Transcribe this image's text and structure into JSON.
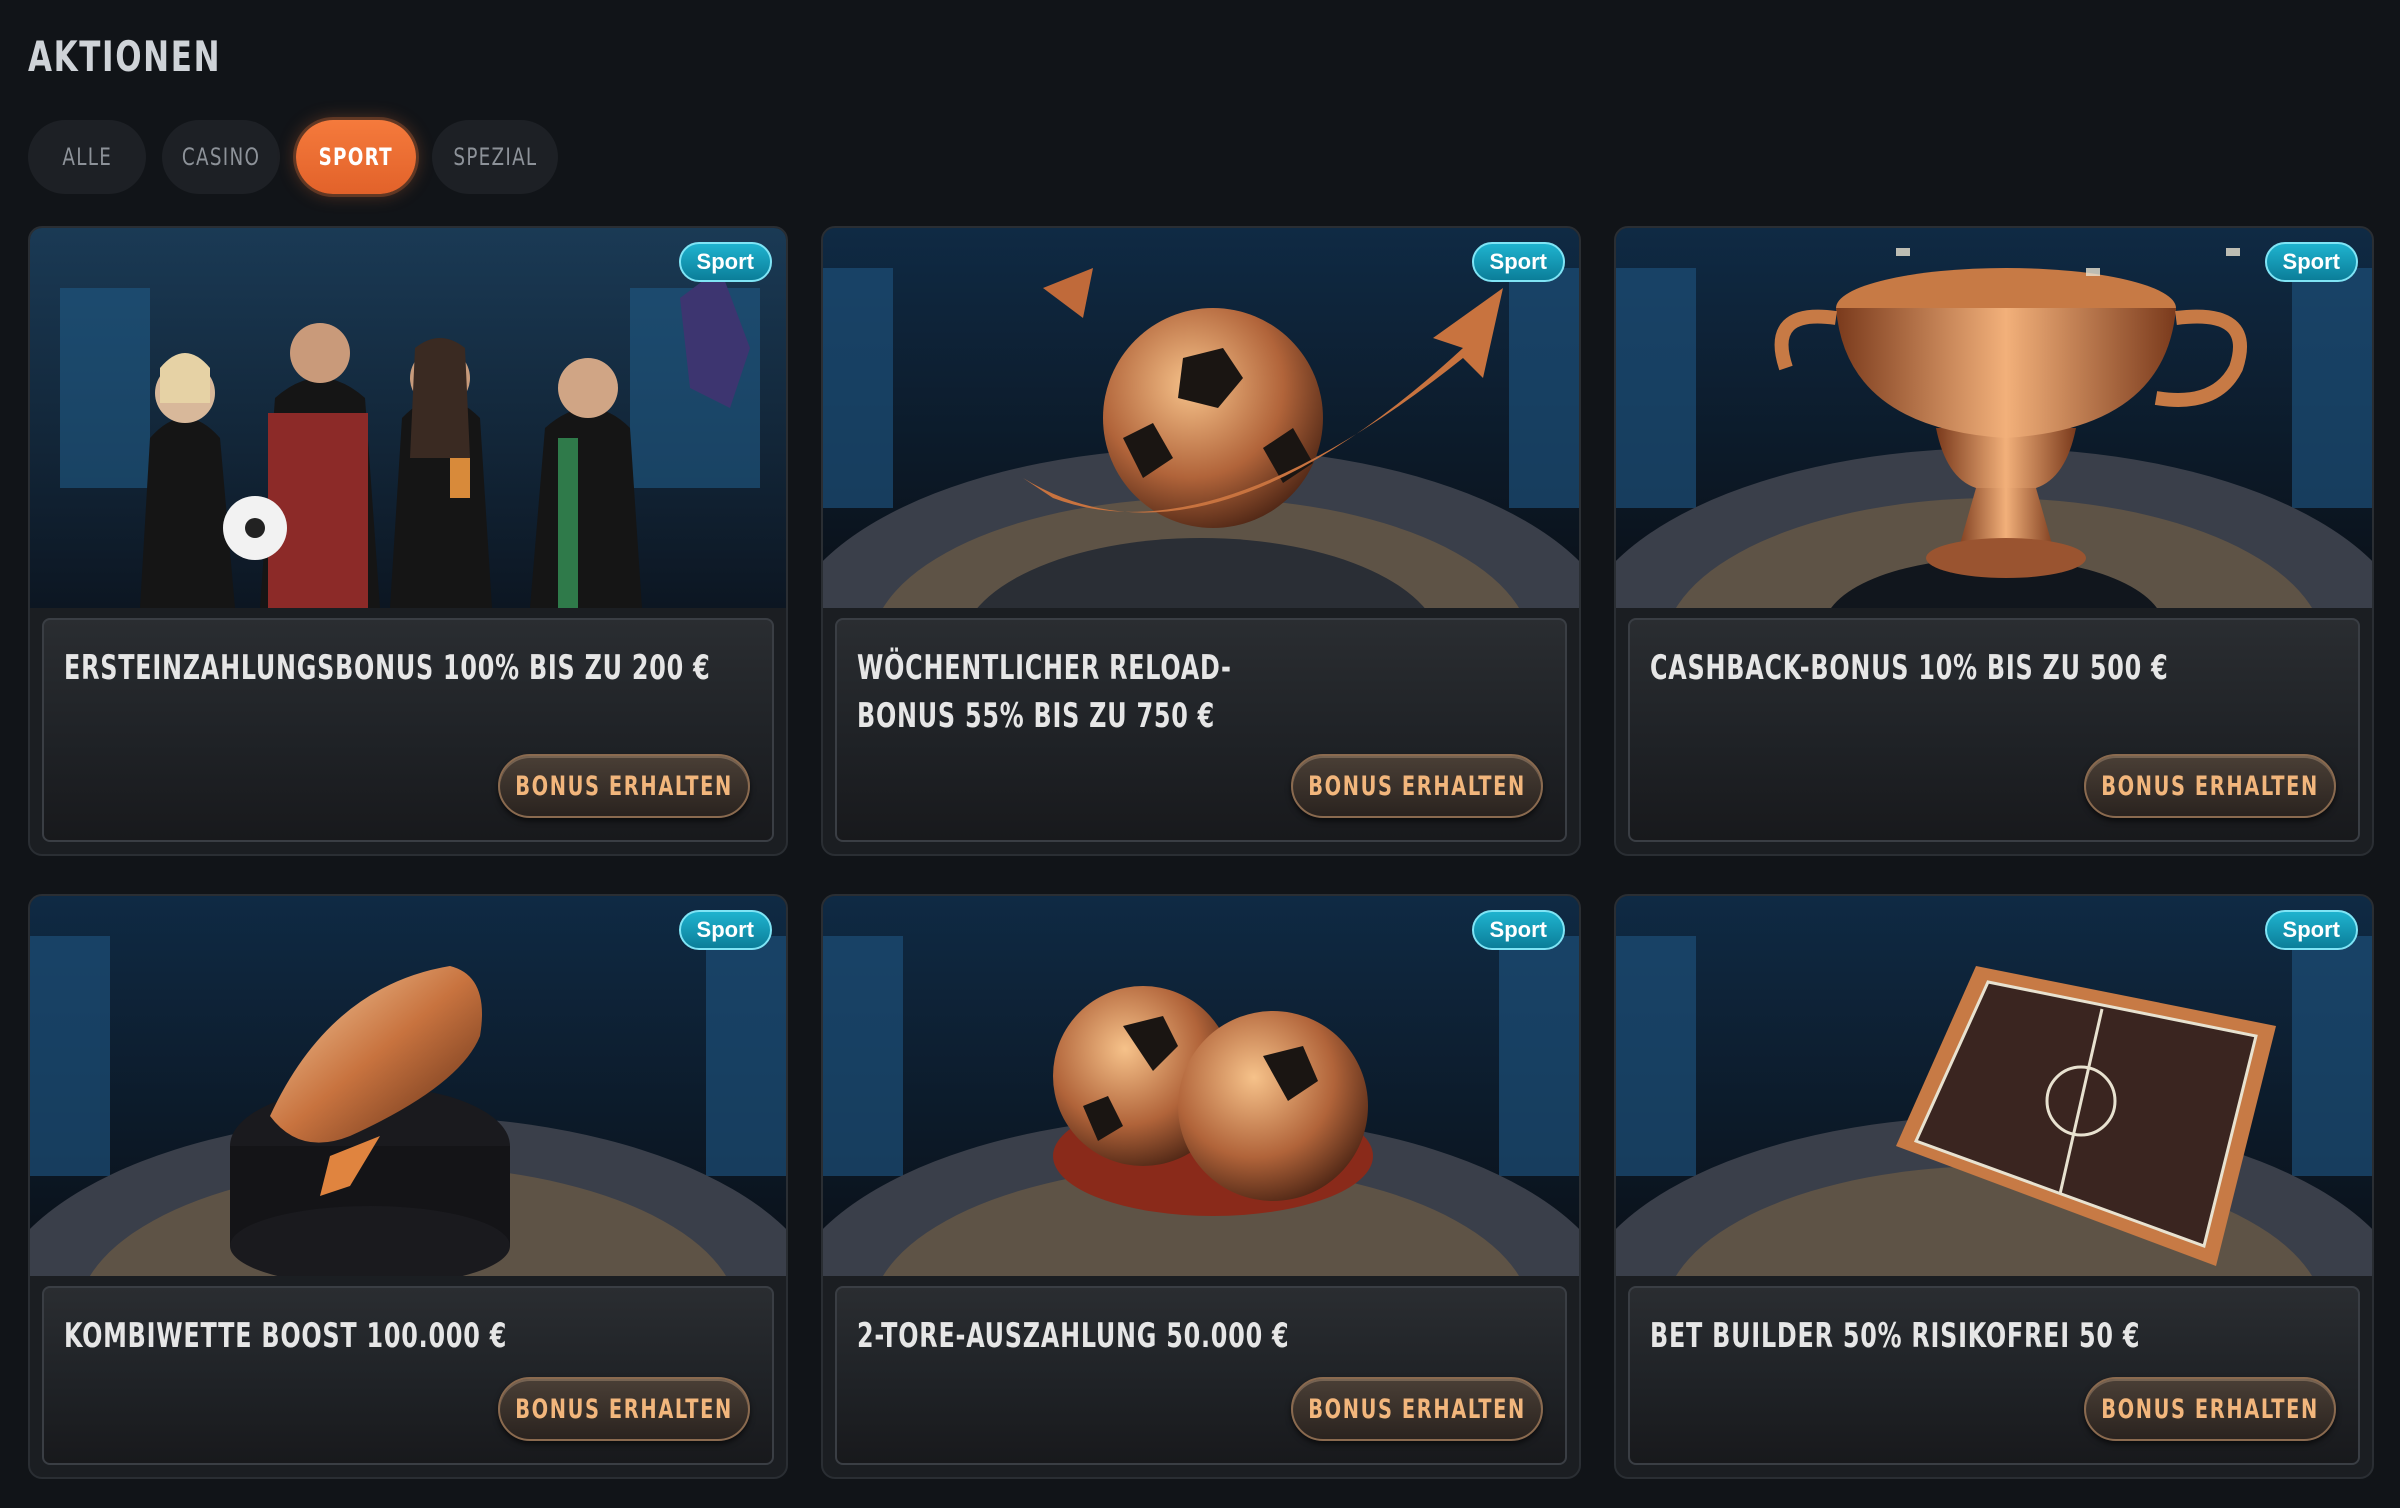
{
  "page": {
    "title": "AKTIONEN"
  },
  "tabs": [
    {
      "label": "ALLE",
      "active": false
    },
    {
      "label": "CASINO",
      "active": false
    },
    {
      "label": "SPORT",
      "active": true
    },
    {
      "label": "SPEZIAL",
      "active": false
    }
  ],
  "colors": {
    "accent": "#f57a3c",
    "badge": "#0b9ab7",
    "button_text": "#f2b67c",
    "background": "#111418"
  },
  "cards": [
    {
      "badge": "Sport",
      "title": "ERSTEINZAHLUNGSBONUS 100% BIS ZU 200 €",
      "button": "BONUS ERHALTEN",
      "image": "team-characters-celebrating"
    },
    {
      "badge": "Sport",
      "title": "WÖCHENTLICHER RELOAD-BONUS 55% BIS ZU 750 €",
      "button": "BONUS ERHALTEN",
      "image": "copper-football-with-arrow"
    },
    {
      "badge": "Sport",
      "title": "CASHBACK-BONUS 10% BIS ZU 500 €",
      "button": "BONUS ERHALTEN",
      "image": "copper-trophy-cup"
    },
    {
      "badge": "Sport",
      "title": "KOMBIWETTE BOOST 100.000 €",
      "button": "BONUS ERHALTEN",
      "image": "copper-football-boot"
    },
    {
      "badge": "Sport",
      "title": "2-TORE-AUSZAHLUNG 50.000 €",
      "button": "BONUS ERHALTEN",
      "image": "two-copper-footballs"
    },
    {
      "badge": "Sport",
      "title": "BET BUILDER 50% RISIKOFREI 50 €",
      "button": "BONUS ERHALTEN",
      "image": "tactics-board"
    }
  ]
}
